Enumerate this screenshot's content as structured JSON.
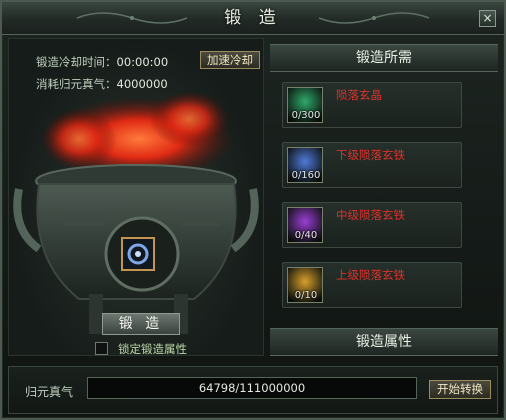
{
  "window": {
    "title": "锻 造",
    "close_label": "×"
  },
  "left": {
    "cooldown_label": "锻造冷却时间：",
    "cooldown_value": "00:00:00",
    "cost_label": "消耗归元真气：",
    "cost_value": "4000000",
    "speed_button": "加速冷却",
    "forge_button": "锻 造",
    "lock_label": "锁定锻造属性"
  },
  "right": {
    "requirements_header": "锻造所需",
    "items": [
      {
        "name": "陨落玄晶",
        "count": "0/300",
        "icon": "green-crystal-icon",
        "color": "#2fa86a"
      },
      {
        "name": "下级陨落玄铁",
        "count": "0/160",
        "icon": "blue-ore-icon",
        "color": "#4f7ad8"
      },
      {
        "name": "中级陨落玄铁",
        "count": "0/40",
        "icon": "purple-ore-icon",
        "color": "#9b3ed6"
      },
      {
        "name": "上级陨落玄铁",
        "count": "0/10",
        "icon": "gold-ore-icon",
        "color": "#d8a02c"
      }
    ],
    "attributes_header": "锻造属性"
  },
  "bottom": {
    "qi_label": "归元真气",
    "qi_value": "64798/111000000",
    "convert_button": "开始转换"
  },
  "colors": {
    "item_name": "#e0302a",
    "accent_gold": "#c59452"
  }
}
